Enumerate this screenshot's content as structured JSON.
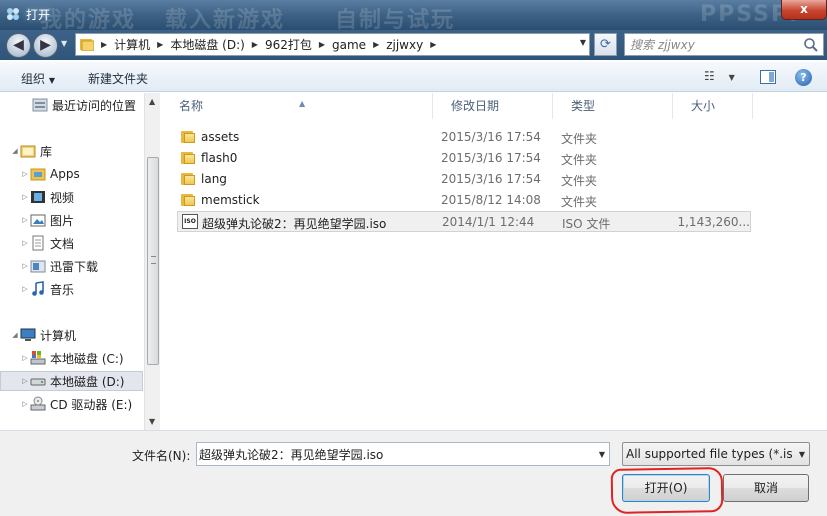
{
  "window": {
    "title": "打开",
    "close_label": "x",
    "background_text": [
      "我的游戏",
      "载入新游戏",
      "自制与试玩",
      "PPSSPP"
    ]
  },
  "address": {
    "crumbs": [
      "计算机",
      "本地磁盘 (D:)",
      "962打包",
      "game",
      "zjjwxy"
    ]
  },
  "search": {
    "placeholder": "搜索 zjjwxy"
  },
  "toolbar": {
    "organize_label": "组织",
    "new_folder_label": "新建文件夹"
  },
  "nav": {
    "items": [
      {
        "label": "最近访问的位置",
        "icon": "recent-places-icon"
      },
      {
        "label": "库",
        "icon": "library-icon"
      },
      {
        "label": "Apps",
        "icon": "apps-folder-icon"
      },
      {
        "label": "视频",
        "icon": "video-icon"
      },
      {
        "label": "图片",
        "icon": "picture-icon"
      },
      {
        "label": "文档",
        "icon": "document-icon"
      },
      {
        "label": "迅雷下载",
        "icon": "thunder-download-icon"
      },
      {
        "label": "音乐",
        "icon": "music-icon"
      },
      {
        "label": "计算机",
        "icon": "computer-icon"
      },
      {
        "label": "本地磁盘 (C:)",
        "icon": "system-drive-icon"
      },
      {
        "label": "本地磁盘 (D:)",
        "icon": "drive-icon"
      },
      {
        "label": "CD 驱动器 (E:)",
        "icon": "cd-drive-icon"
      }
    ]
  },
  "filelist": {
    "columns": [
      "名称",
      "修改日期",
      "类型",
      "大小"
    ],
    "rows": [
      {
        "name": "assets",
        "date": "2015/3/16 17:54",
        "type": "文件夹",
        "size": "",
        "icon": "folder-icon"
      },
      {
        "name": "flash0",
        "date": "2015/3/16 17:54",
        "type": "文件夹",
        "size": "",
        "icon": "folder-icon"
      },
      {
        "name": "lang",
        "date": "2015/3/16 17:54",
        "type": "文件夹",
        "size": "",
        "icon": "folder-icon"
      },
      {
        "name": "memstick",
        "date": "2015/8/12 14:08",
        "type": "文件夹",
        "size": "",
        "icon": "folder-icon"
      },
      {
        "name": "超级弹丸论破2：再见绝望学园.iso",
        "date": "2014/1/1 12:44",
        "type": "ISO 文件",
        "size": "1,143,260...",
        "icon": "iso-file-icon"
      }
    ]
  },
  "bottom": {
    "filename_label": "文件名(N):",
    "filename_value": "超级弹丸论破2：再见绝望学园.iso",
    "filetype_value": "All supported file types (*.iso",
    "open_label": "打开(O)",
    "cancel_label": "取消"
  },
  "colors": {
    "title_bar": "#3f6487",
    "selection": "#e3e7ed",
    "annotation_red": "#e02222"
  }
}
